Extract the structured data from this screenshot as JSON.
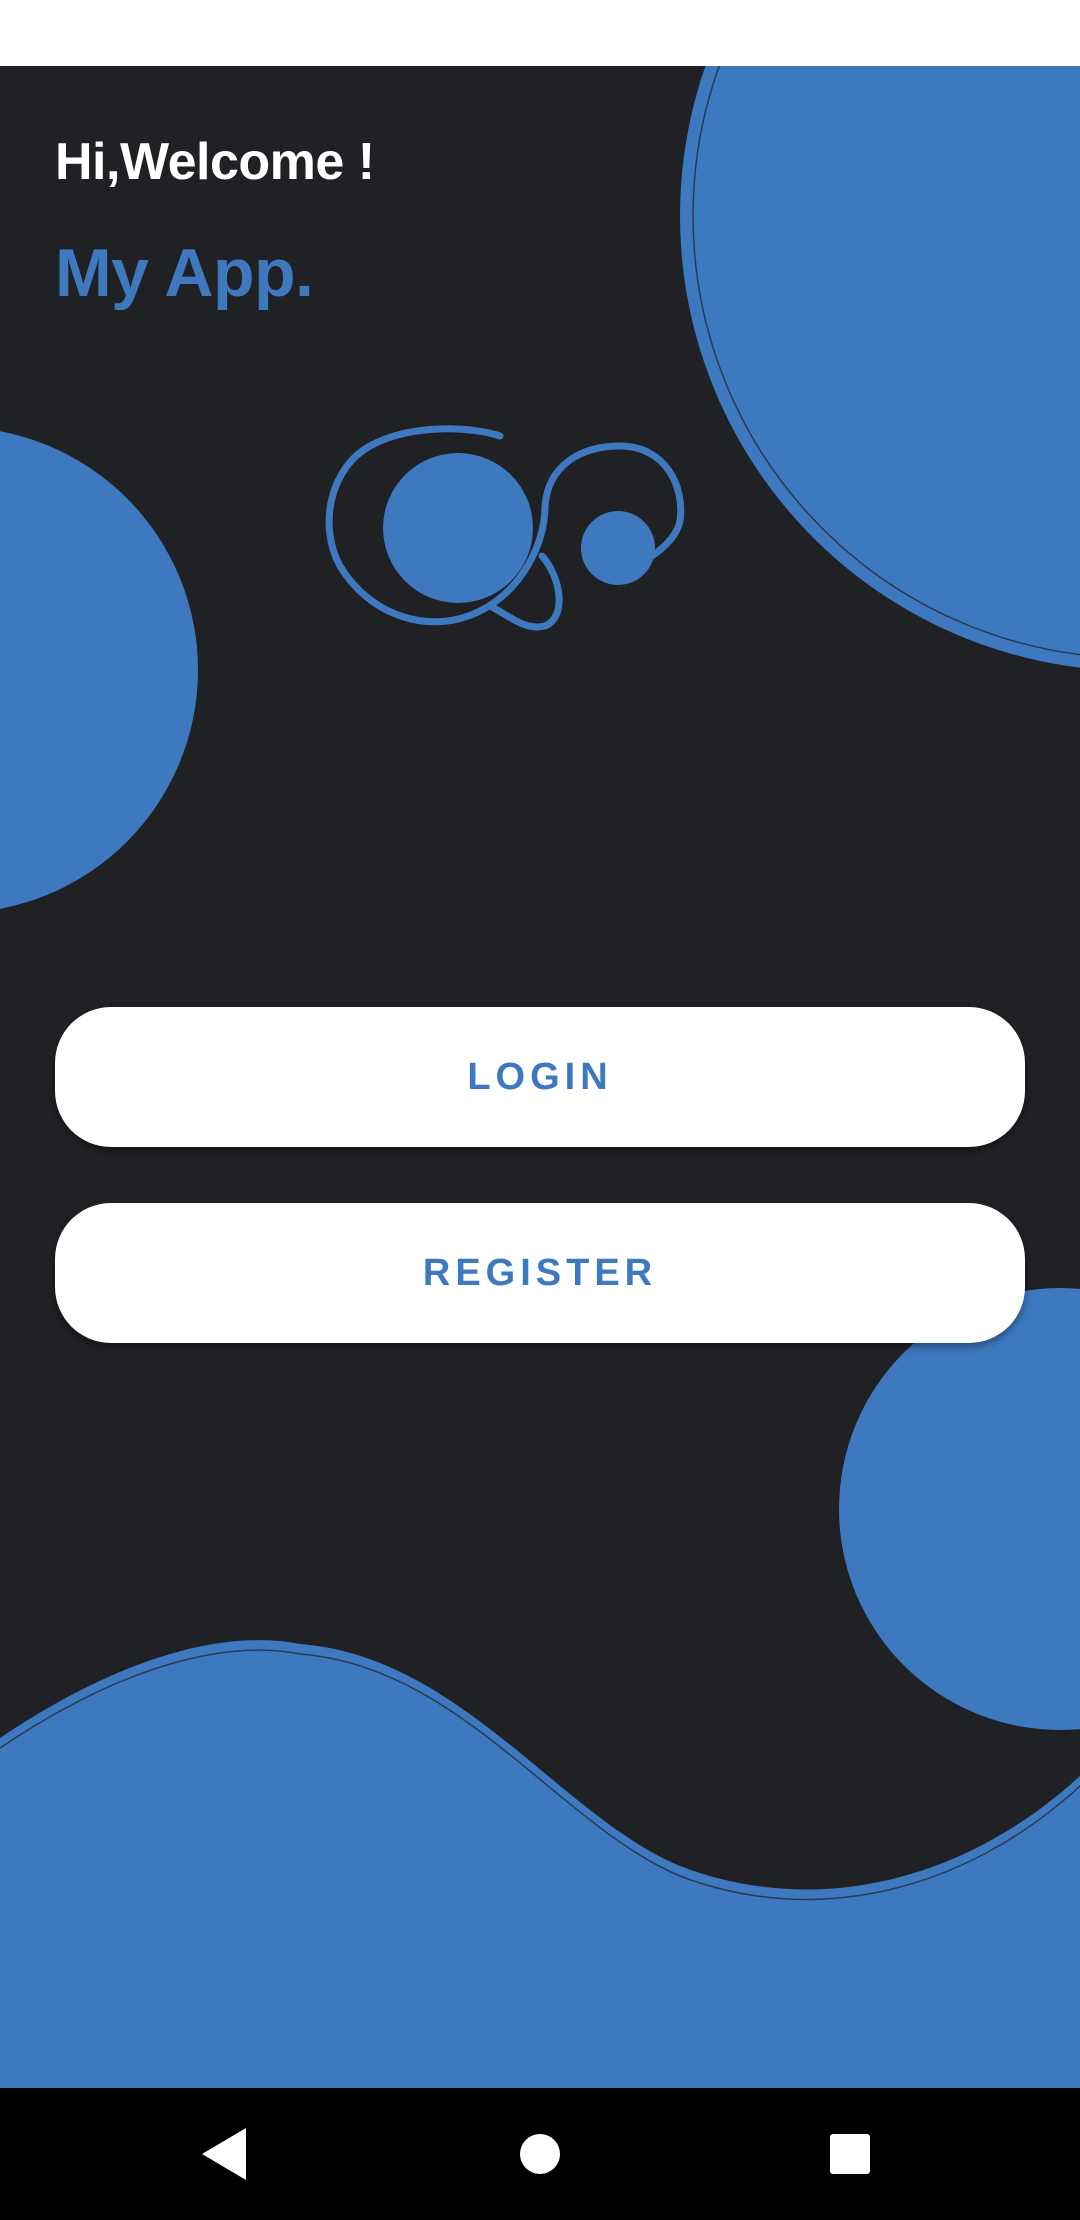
{
  "greeting": "Hi,Welcome !",
  "app_name": "My App.",
  "logo": {
    "icon": "app-logo-icon"
  },
  "actions": {
    "login_label": "LOGIN",
    "register_label": "REGISTER"
  },
  "navigation_bar": {
    "back_icon": "back-triangle-icon",
    "home_icon": "home-circle-icon",
    "recents_icon": "recents-square-icon"
  },
  "colors": {
    "accent": "#3e78bf",
    "background": "#202124",
    "button_background": "#ffffff",
    "status_bar": "#ffffff",
    "navigation_bar": "#000000"
  }
}
